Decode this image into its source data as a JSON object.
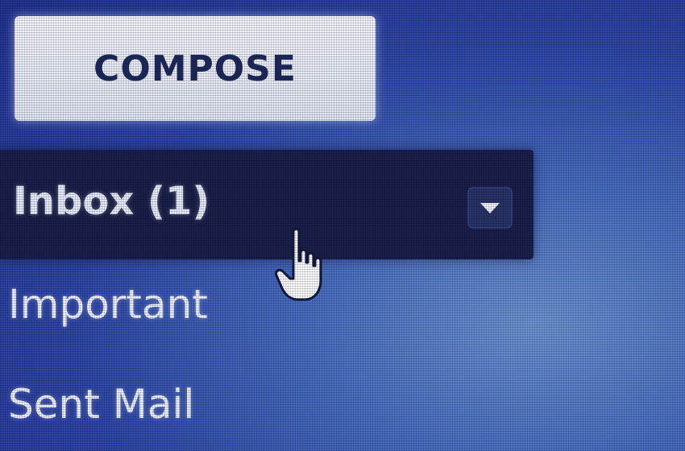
{
  "compose": {
    "label": "COMPOSE"
  },
  "nav": {
    "inbox": {
      "label": "Inbox (1)",
      "selected": true
    },
    "important": {
      "label": "Important"
    },
    "sent": {
      "label": "Sent Mail"
    }
  },
  "icons": {
    "dropdown": "triangle-down-icon",
    "cursor": "hand-pointer-icon"
  },
  "colors": {
    "background": "#2e47a6",
    "selected_row": "#1a2048",
    "compose_bg": "#eef1f8",
    "compose_text": "#1e2a5a"
  }
}
